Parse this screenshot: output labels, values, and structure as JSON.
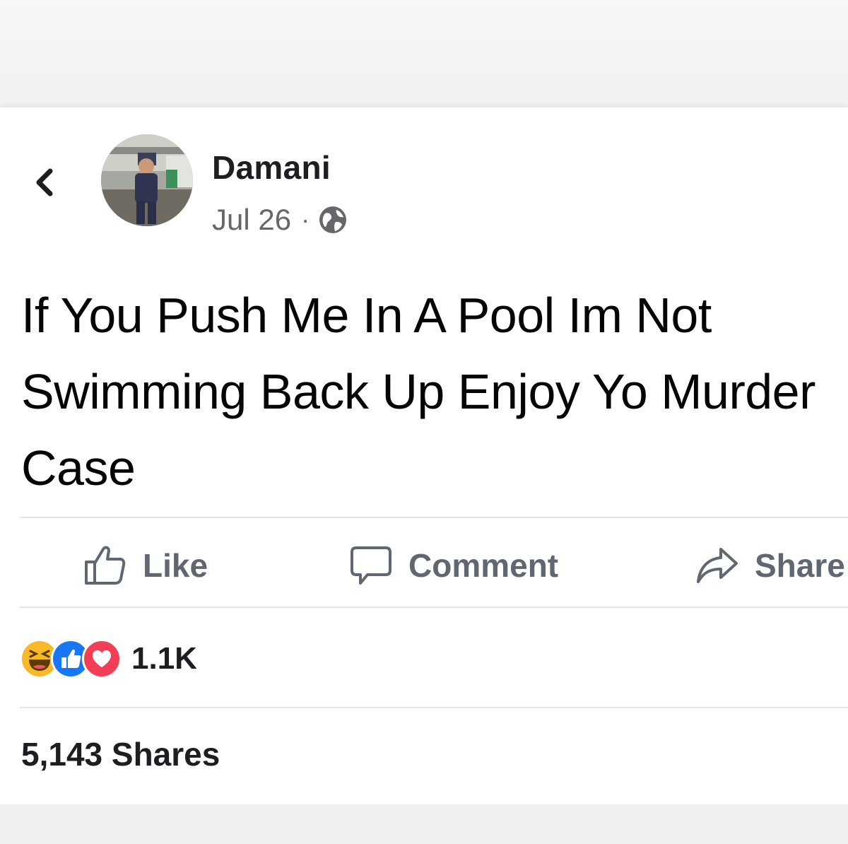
{
  "post": {
    "author": "Damani",
    "date": "Jul 26",
    "separator": "·",
    "privacy_icon": "globe-icon",
    "text": "If You Push Me In A Pool Im Not Swimming Back Up Enjoy Yo Murder Case"
  },
  "actions": {
    "like_label": "Like",
    "comment_label": "Comment",
    "share_label": "Share"
  },
  "stats": {
    "reactions": [
      "haha",
      "like",
      "love"
    ],
    "reaction_count": "1.1K",
    "shares_text": "5,143 Shares"
  },
  "colors": {
    "like_blue": "#1877f2",
    "love_red": "#f33e58",
    "haha_yellow": "#f7b928",
    "muted_text": "#65676b"
  }
}
